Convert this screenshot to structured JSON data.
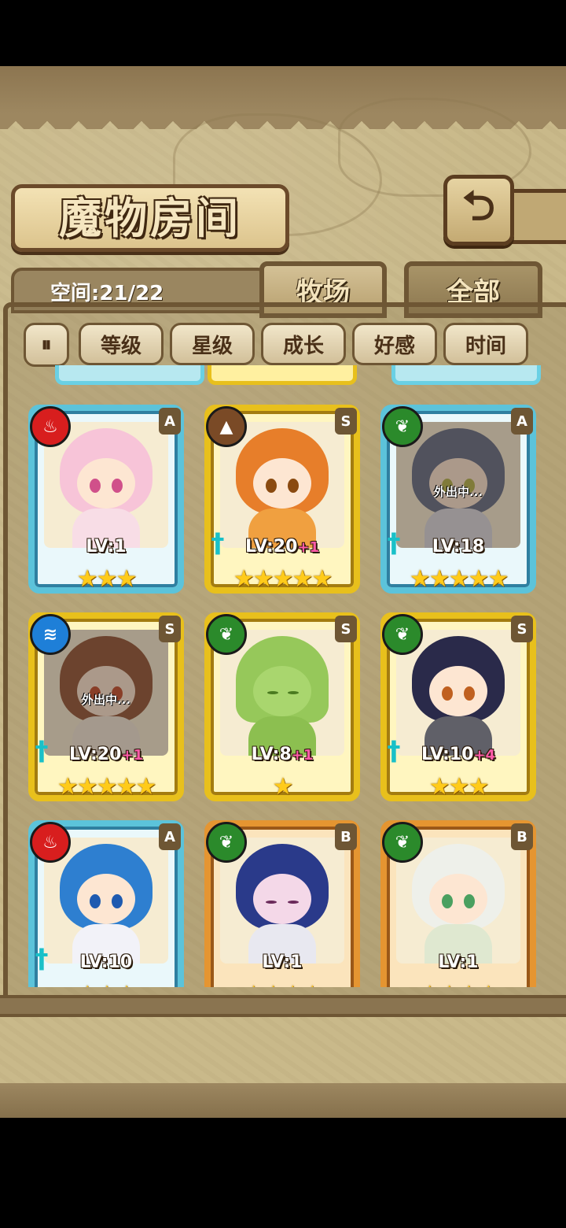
{
  "header": {
    "title": "魔物房间",
    "back_icon": "back-arrow-icon"
  },
  "space": {
    "label": "空间:21/22"
  },
  "tabs": [
    {
      "label": "牧场",
      "selected": true
    },
    {
      "label": "全部",
      "selected": false
    }
  ],
  "filters": {
    "toggle_icon": "sort-toggle-icon",
    "buttons": [
      "等级",
      "星级",
      "成长",
      "好感",
      "时间"
    ]
  },
  "colors": {
    "rank_A": "#5cc3da",
    "rank_S": "#e8c01c",
    "rank_B": "#e59531",
    "level_bonus": "#ff5ba8"
  },
  "monsters": [
    {
      "element": "fire",
      "rank": "A",
      "level": "LV:1",
      "bonus": "",
      "stars": "★★★",
      "status": "",
      "has_weapon": false
    },
    {
      "element": "earth",
      "rank": "S",
      "level": "LV:20",
      "bonus": "+1",
      "stars": "★★★★★",
      "status": "",
      "has_weapon": true
    },
    {
      "element": "nature",
      "rank": "A",
      "level": "LV:18",
      "bonus": "",
      "stars": "★★★★★",
      "status": "外出中...",
      "has_weapon": true
    },
    {
      "element": "water",
      "rank": "S",
      "level": "LV:20",
      "bonus": "+1",
      "stars": "★★★★★",
      "status": "外出中...",
      "has_weapon": true
    },
    {
      "element": "nature",
      "rank": "S",
      "level": "LV:8",
      "bonus": "+1",
      "stars": "★",
      "status": "",
      "has_weapon": false
    },
    {
      "element": "nature",
      "rank": "S",
      "level": "LV:10",
      "bonus": "+4",
      "stars": "★★★",
      "status": "",
      "has_weapon": true
    },
    {
      "element": "fire",
      "rank": "A",
      "level": "LV:10",
      "bonus": "",
      "stars": "★★★",
      "status": "",
      "has_weapon": true
    },
    {
      "element": "nature",
      "rank": "B",
      "level": "LV:1",
      "bonus": "",
      "stars": "★★★★",
      "status": "",
      "has_weapon": false
    },
    {
      "element": "nature",
      "rank": "B",
      "level": "LV:1",
      "bonus": "",
      "stars": "★★★★",
      "status": "",
      "has_weapon": false
    }
  ]
}
